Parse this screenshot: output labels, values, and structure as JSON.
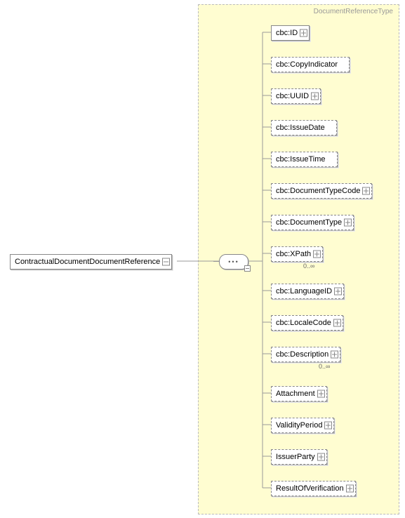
{
  "root": {
    "name": "ContractualDocumentDocumentReference"
  },
  "type_label": "DocumentReferenceType",
  "children": [
    {
      "name": "cbc:ID",
      "optional": false,
      "occ": ""
    },
    {
      "name": "cbc:CopyIndicator",
      "optional": true,
      "occ": ""
    },
    {
      "name": "cbc:UUID",
      "optional": true,
      "occ": ""
    },
    {
      "name": "cbc:IssueDate",
      "optional": true,
      "occ": ""
    },
    {
      "name": "cbc:IssueTime",
      "optional": true,
      "occ": ""
    },
    {
      "name": "cbc:DocumentTypeCode",
      "optional": true,
      "occ": ""
    },
    {
      "name": "cbc:DocumentType",
      "optional": true,
      "occ": ""
    },
    {
      "name": "cbc:XPath",
      "optional": true,
      "occ": "0..∞"
    },
    {
      "name": "cbc:LanguageID",
      "optional": true,
      "occ": ""
    },
    {
      "name": "cbc:LocaleCode",
      "optional": true,
      "occ": ""
    },
    {
      "name": "cbc:Description",
      "optional": true,
      "occ": "0..∞"
    },
    {
      "name": "Attachment",
      "optional": true,
      "occ": ""
    },
    {
      "name": "ValidityPeriod",
      "optional": true,
      "occ": ""
    },
    {
      "name": "IssuerParty",
      "optional": true,
      "occ": ""
    },
    {
      "name": "ResultOfVerification",
      "optional": true,
      "occ": ""
    }
  ]
}
